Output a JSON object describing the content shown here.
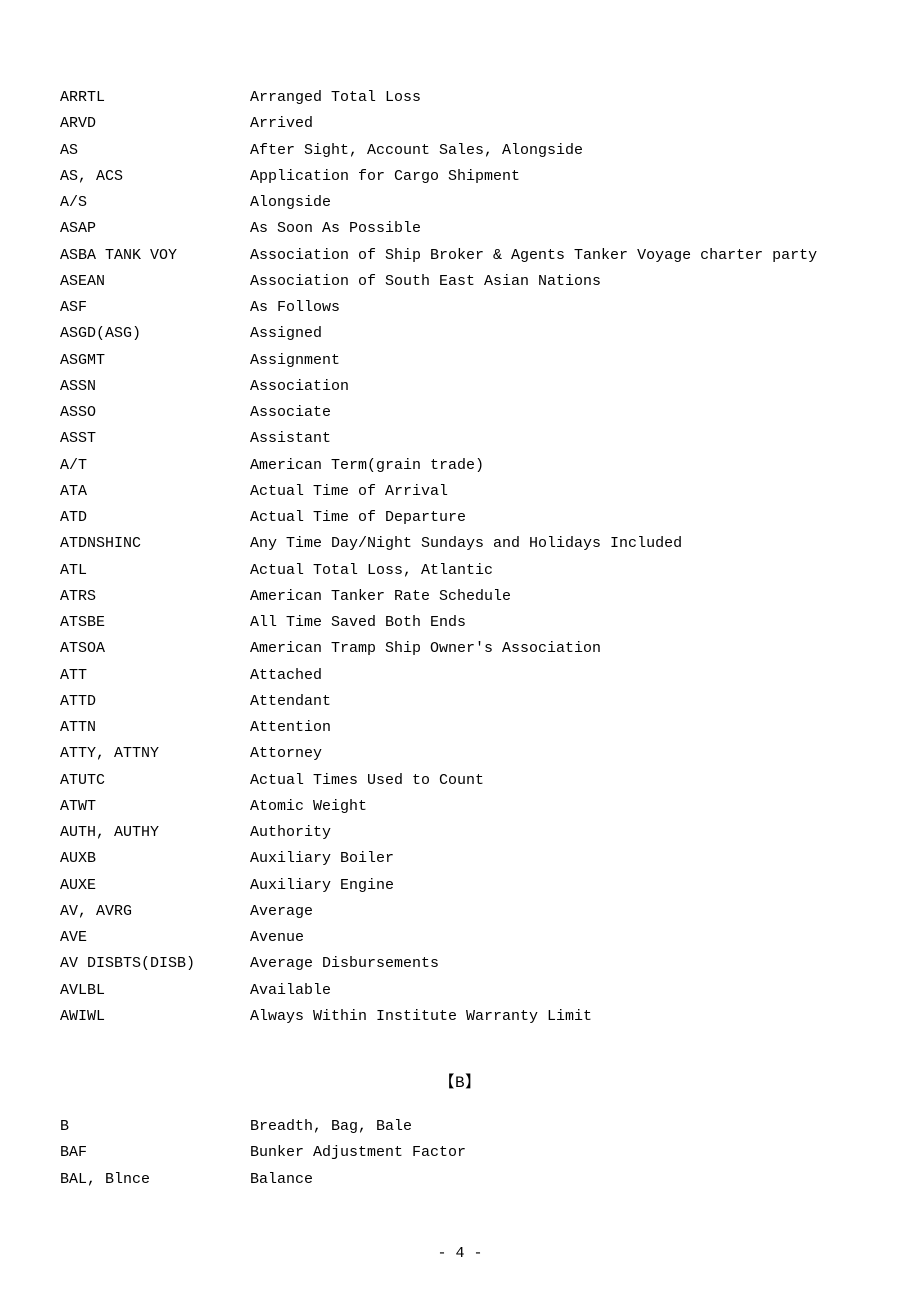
{
  "sections": [
    {
      "header": null,
      "entries": [
        {
          "abbr": "ARRTL",
          "def": "Arranged Total Loss"
        },
        {
          "abbr": "ARVD",
          "def": "Arrived"
        },
        {
          "abbr": "AS",
          "def": "After Sight, Account Sales, Alongside"
        },
        {
          "abbr": "AS, ACS",
          "def": "Application for Cargo Shipment"
        },
        {
          "abbr": "A/S",
          "def": "Alongside"
        },
        {
          "abbr": "ASAP",
          "def": "As Soon As Possible"
        },
        {
          "abbr": "ASBA TANK VOY",
          "def": "Association of Ship Broker & Agents Tanker Voyage charter party"
        },
        {
          "abbr": "ASEAN",
          "def": "Association of South East Asian Nations"
        },
        {
          "abbr": "ASF",
          "def": "As Follows"
        },
        {
          "abbr": "ASGD(ASG)",
          "def": "Assigned"
        },
        {
          "abbr": "ASGMT",
          "def": "Assignment"
        },
        {
          "abbr": "ASSN",
          "def": "Association"
        },
        {
          "abbr": "ASSO",
          "def": "Associate"
        },
        {
          "abbr": "ASST",
          "def": "Assistant"
        },
        {
          "abbr": "A/T",
          "def": "American Term(grain trade)"
        },
        {
          "abbr": "ATA",
          "def": "Actual Time of Arrival"
        },
        {
          "abbr": "ATD",
          "def": "Actual Time of Departure"
        },
        {
          "abbr": "ATDNSHINC",
          "def": "Any Time Day/Night Sundays and Holidays Included"
        },
        {
          "abbr": "ATL",
          "def": "Actual Total Loss, Atlantic"
        },
        {
          "abbr": "ATRS",
          "def": "American Tanker Rate Schedule"
        },
        {
          "abbr": "ATSBE",
          "def": "All Time Saved Both Ends"
        },
        {
          "abbr": "ATSOA",
          "def": "American Tramp Ship Owner's Association"
        },
        {
          "abbr": "ATT",
          "def": "Attached"
        },
        {
          "abbr": "ATTD",
          "def": "Attendant"
        },
        {
          "abbr": "ATTN",
          "def": "Attention"
        },
        {
          "abbr": "ATTY, ATTNY",
          "def": "Attorney"
        },
        {
          "abbr": "ATUTC",
          "def": "Actual Times Used to Count"
        },
        {
          "abbr": "ATWT",
          "def": "Atomic Weight"
        },
        {
          "abbr": "AUTH, AUTHY",
          "def": "Authority"
        },
        {
          "abbr": "AUXB",
          "def": "Auxiliary Boiler"
        },
        {
          "abbr": "AUXE",
          "def": "Auxiliary Engine"
        },
        {
          "abbr": "AV, AVRG",
          "def": "Average"
        },
        {
          "abbr": "AVE",
          "def": "Avenue"
        },
        {
          "abbr": "AV DISBTS(DISB)",
          "def": "Average Disbursements"
        },
        {
          "abbr": "AVLBL",
          "def": "Available"
        },
        {
          "abbr": "AWIWL",
          "def": "Always Within Institute Warranty Limit"
        }
      ]
    },
    {
      "header": "【B】",
      "entries": [
        {
          "abbr": "B",
          "def": "Breadth, Bag, Bale"
        },
        {
          "abbr": "BAF",
          "def": "Bunker Adjustment Factor"
        },
        {
          "abbr": "BAL, Blnce",
          "def": "Balance"
        }
      ]
    }
  ],
  "pageNumber": "- 4 -"
}
